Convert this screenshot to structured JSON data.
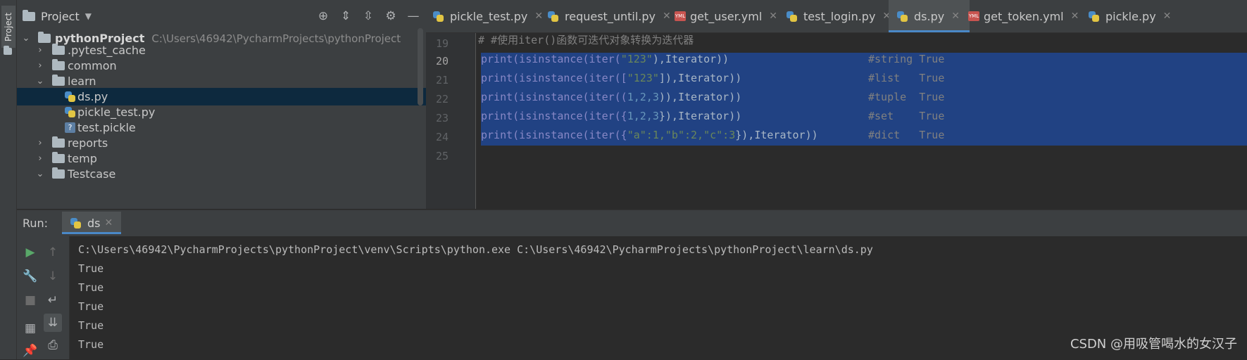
{
  "stripe": {
    "label": "Project"
  },
  "project": {
    "title": "Project",
    "root_name": "pythonProject",
    "root_path": "C:\\Users\\46942\\PycharmProjects\\pythonProject",
    "items": [
      {
        "label": ".pytest_cache"
      },
      {
        "label": "common"
      },
      {
        "label": "learn"
      },
      {
        "label": "ds.py"
      },
      {
        "label": "pickle_test.py"
      },
      {
        "label": "test.pickle"
      },
      {
        "label": "reports"
      },
      {
        "label": "temp"
      },
      {
        "label": "Testcase"
      }
    ]
  },
  "tabs": [
    {
      "label": "pickle_test.py"
    },
    {
      "label": "request_until.py"
    },
    {
      "label": "get_user.yml"
    },
    {
      "label": "test_login.py"
    },
    {
      "label": "ds.py"
    },
    {
      "label": "get_token.yml"
    },
    {
      "label": "pickle.py"
    }
  ],
  "editor": {
    "lines": [
      "19",
      "20",
      "21",
      "22",
      "23",
      "24",
      "25"
    ],
    "comment": "# #使用iter()函数可迭代对象转换为迭代器",
    "code": [
      {
        "pre": "print(isinstance(iter(",
        "s1": "\"123\"",
        "mid": "),Iterator))",
        "cmt": "#string True"
      },
      {
        "pre": "print(isinstance(iter([",
        "s1": "\"123\"",
        "mid": "]),Iterator))",
        "cmt": "#list   True"
      },
      {
        "pre": "print(isinstance(iter((",
        "s1": "1,2,3",
        "mid": ")),Iterator))",
        "cmt": "#tuple  True"
      },
      {
        "pre": "print(isinstance(iter({",
        "s1": "1,2,3",
        "mid": "}),Iterator))",
        "cmt": "#set    True"
      },
      {
        "pre": "print(isinstance(iter({",
        "s1": "\"a\":1,\"b\":2,\"c\":3",
        "mid": "}),Iterator))",
        "cmt": "#dict   True"
      }
    ]
  },
  "run": {
    "label": "Run:",
    "tab": "ds",
    "command": "C:\\Users\\46942\\PycharmProjects\\pythonProject\\venv\\Scripts\\python.exe C:\\Users\\46942\\PycharmProjects\\pythonProject\\learn\\ds.py",
    "output": [
      "True",
      "True",
      "True",
      "True",
      "True"
    ]
  },
  "watermark": "CSDN @用吸管喝水的女汉子"
}
